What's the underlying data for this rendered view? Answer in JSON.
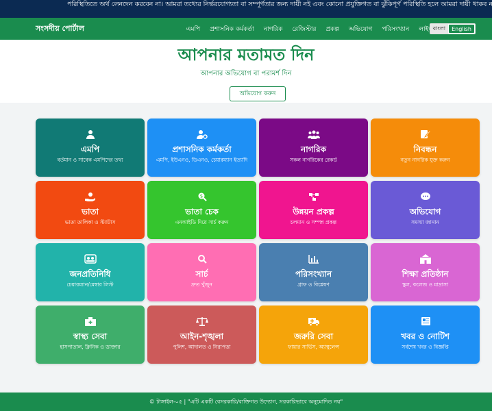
{
  "ticker": "পরিস্থিতিতে অর্থ লেনদেন করবেন না। আমরা তথ্যের নির্ভরযোগ্যতা বা সম্পূর্ণতার জন্য দায়ী নই এবং কোনো প্রযুক্তিগত বা ঝুঁকিপূর্ণ পরিস্থিতি হলে আমরা দায়ী থাকব না।",
  "navbar": {
    "brand": "সংসদীয় পোর্টাল",
    "links": [
      "এমপি",
      "প্রশাসনিক কর্মকর্তা",
      "নাগরিক",
      "রেজিস্টার",
      "প্রকল্প",
      "অভিযোগ",
      "পরিসংখ্যান",
      "লাইভ"
    ],
    "lang_bn": "বাংলা",
    "lang_en": "English"
  },
  "hero": {
    "title": "আপনার মতামত দিন",
    "subtitle": "আপনার অভিযোগ বা পরামর্শ দিন",
    "button": "অভিযোগ করুন"
  },
  "cards": [
    {
      "title": "এমপি",
      "desc": "বর্তমান ও সাবেক এমপিদের তথ্য",
      "color": "#117a75",
      "icon": "user-tie-icon"
    },
    {
      "title": "প্রশাসনিক কর্মকর্তা",
      "desc": "এমপি, ইউএনও, ডিএনও, চেয়ারম্যান ইত্যাদি",
      "color": "#1e90f5",
      "icon": "user-gear-icon"
    },
    {
      "title": "নাগরিক",
      "desc": "সকল নাগরিকের রেকর্ড",
      "color": "#7b0a86",
      "icon": "users-icon"
    },
    {
      "title": "নিবন্ধন",
      "desc": "নতুন নাগরিক যুক্ত করুন",
      "color": "#f58c0a",
      "icon": "edit-icon"
    },
    {
      "title": "ভাতা",
      "desc": "ভাতা তালিকা ও স্ট্যাটাস",
      "color": "#f24a11",
      "icon": "hand-coin-icon"
    },
    {
      "title": "ভাতা চেক",
      "desc": "এনআইডি দিয়ে সার্চ করুন",
      "color": "#35c52e",
      "icon": "search-dollar-icon"
    },
    {
      "title": "উন্নয়ন প্রকল্প",
      "desc": "চলমান ও সম্পন্ন প্রকল্প",
      "color": "#f0158f",
      "icon": "project-diagram-icon"
    },
    {
      "title": "অভিযোগ",
      "desc": "সমস্যা জানান",
      "color": "#6a5ad6",
      "icon": "comment-dots-icon"
    },
    {
      "title": "জনপ্রতিনিধি",
      "desc": "চেয়ারম্যান/মেম্বার লিস্ট",
      "color": "#22b3aa",
      "icon": "id-card-icon"
    },
    {
      "title": "সার্চ",
      "desc": "দ্রুত খুঁজুন",
      "color": "#ff6eb3",
      "icon": "search-icon"
    },
    {
      "title": "পরিসংখ্যান",
      "desc": "গ্রাফ ও বিশ্লেষণ",
      "color": "#4a7fb0",
      "icon": "chart-bar-icon"
    },
    {
      "title": "শিক্ষা প্রতিষ্ঠান",
      "desc": "স্কুল, কলেজ ও মাদ্রাসা",
      "color": "#d966d3",
      "icon": "school-icon"
    },
    {
      "title": "স্বাস্থ্য সেবা",
      "desc": "হাসপাতাল, ক্লিনিক ও ডাক্তার",
      "color": "#3fae6b",
      "icon": "hospital-icon"
    },
    {
      "title": "আইন-শৃঙ্খলা",
      "desc": "পুলিশ, আদালত ও নিরাপত্তা",
      "color": "#cc5a5a",
      "icon": "scale-icon"
    },
    {
      "title": "জরুরি সেবা",
      "desc": "ফায়ার সার্ভিস, অ্যাম্বুলেন্স",
      "color": "#f5a40a",
      "icon": "ambulance-icon"
    },
    {
      "title": "খবর ও নোটিশ",
      "desc": "সর্বশেষ খবর ও বিজ্ঞপ্তি",
      "color": "#1e90f5",
      "icon": "newspaper-icon"
    }
  ],
  "footer": "© টাঙ্গাইল-০৫ | \"এটি একটি বেসরকারি/ব্যক্তিগত উদ্যোগ, সরকারিভাবে অনুমোদিত নয়\""
}
